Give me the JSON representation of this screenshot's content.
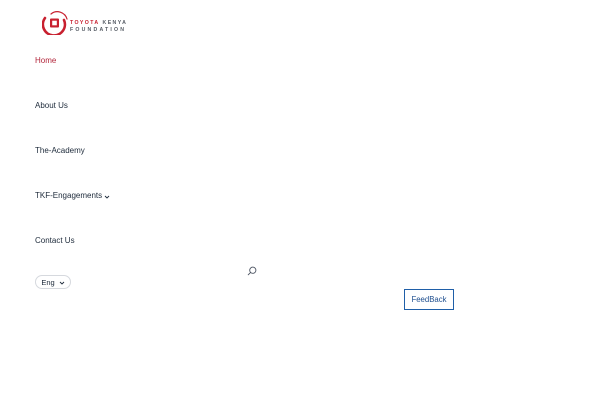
{
  "logo": {
    "line1_word1": "TOYOTA",
    "line1_word2": "KENYA",
    "line2": "FOUNDATION",
    "brand_red": "#c8202f",
    "brand_gray": "#555b64"
  },
  "nav": {
    "items": [
      {
        "label": "Home",
        "active": true
      },
      {
        "label": "About Us",
        "active": false
      },
      {
        "label": "The-Academy",
        "active": false
      },
      {
        "label": "TKF-Engagements",
        "active": false,
        "has_dropdown": true,
        "icon": "chevron-down-icon"
      },
      {
        "label": "Contact Us",
        "active": false
      }
    ]
  },
  "language": {
    "selected": "Eng",
    "icon": "chevron-down-icon"
  },
  "search": {
    "icon": "search-icon"
  },
  "feedback": {
    "label": "FeedBack",
    "accent": "#1f5fa8"
  }
}
